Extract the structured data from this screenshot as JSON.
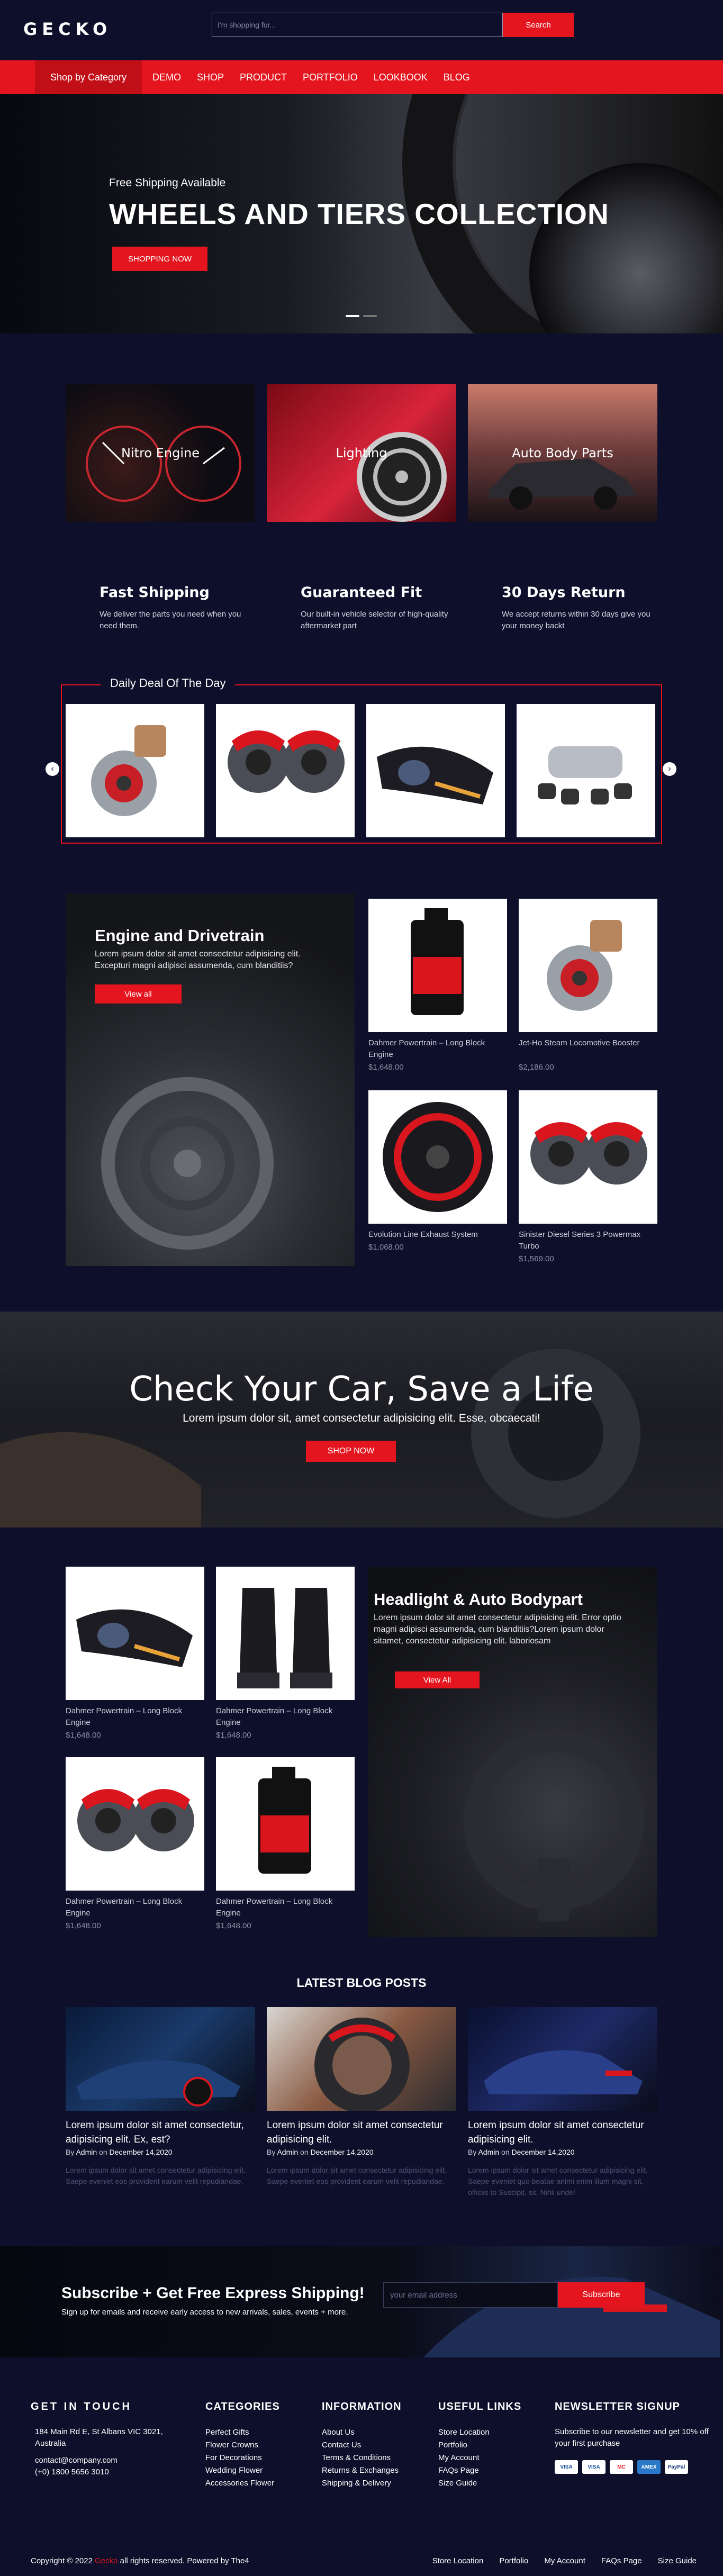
{
  "header": {
    "logo": "GECKO",
    "search_placeholder": "I'm shopping for...",
    "search_button": "Search"
  },
  "nav": {
    "shop_by_category": "Shop by Category",
    "links": [
      "DEMO",
      "SHOP",
      "PRODUCT",
      "PORTFOLIO",
      "LOOKBOOK",
      "BLOG"
    ]
  },
  "hero": {
    "subtitle": "Free Shipping Available",
    "title": "WHEELS AND TIERS COLLECTION",
    "button": "SHOPPING NOW"
  },
  "categories": [
    "Nitro Engine",
    "Lighting",
    "Auto Body Parts"
  ],
  "features": [
    {
      "title": "Fast Shipping",
      "text": "We deliver the parts you need when you need them."
    },
    {
      "title": "Guaranteed Fit",
      "text": "Our built-in vehicle selector of high-quality aftermarket part"
    },
    {
      "title": "30 Days Return",
      "text": "We accept returns within 30 days give you your money backt"
    }
  ],
  "deal": {
    "title": "Daily Deal Of The Day",
    "items": [
      "turbocharger",
      "brake-calipers",
      "headlight",
      "exhaust-system"
    ]
  },
  "engine_section": {
    "banner": {
      "title": "Engine and Drivetrain",
      "text": "Lorem ipsum dolor sit amet consectetur adipisicing elit. Excepturi magni adipisci assumenda, cum blanditiis?",
      "button": "View all"
    },
    "products": [
      {
        "name": "Dahmer Powertrain – Long Block Engine",
        "price": "$1,648.00",
        "image": "oil-bottle"
      },
      {
        "name": "Jet-Ho Steam Locomotive Booster",
        "price": "$2,186.00",
        "image": "turbocharger"
      },
      {
        "name": "Evolution Line Exhaust System",
        "price": "$1,068.00",
        "image": "wheel-rim"
      },
      {
        "name": "Sinister Diesel Series 3 Powermax Turbo",
        "price": "$1,569.00",
        "image": "brake-calipers"
      }
    ]
  },
  "mid_banner": {
    "title": "Check Your Car, Save a Life",
    "subtitle": "Lorem ipsum dolor sit, amet consectetur adipisicing elit. Esse, obcaecati!",
    "button": "SHOP NOW"
  },
  "headlight_section": {
    "banner": {
      "title": "Headlight & Auto Bodypart",
      "text": "Lorem ipsum dolor sit amet consectetur adipisicing elit. Error optio magni adipisci assumenda, cum blanditiis?Lorem ipsum dolor sitamet, consectetur adipisicing elit. laboriosam",
      "button": "View All"
    },
    "products": [
      {
        "name": "Dahmer Powertrain – Long Block Engine",
        "price": "$1,648.00",
        "image": "headlight"
      },
      {
        "name": "Dahmer Powertrain – Long Block Engine",
        "price": "$1,648.00",
        "image": "seats"
      },
      {
        "name": "Dahmer Powertrain – Long Block Engine",
        "price": "$1,648.00",
        "image": "brake-calipers"
      },
      {
        "name": "Dahmer Powertrain – Long Block Engine",
        "price": "$1,648.00",
        "image": "oil-bottle"
      }
    ]
  },
  "blog": {
    "title": "LATEST BLOG POSTS",
    "by": "By",
    "on": "on",
    "posts": [
      {
        "title": "Lorem ipsum dolor sit amet consectetur, adipisicing elit. Ex, est?",
        "author": "Admin",
        "date": "December 14,2020",
        "excerpt": "Lorem ipsum dolor sit amet consectetur adipisicing elit. Saepe eveniet eos provident earum velit repudiandae."
      },
      {
        "title": "Lorem ipsum dolor sit amet consectetur adipisicing elit.",
        "author": "Admin",
        "date": "December 14,2020",
        "excerpt": "Lorem ipsum dolor sit amet consectetur adipisicing elit. Saepe eveniet eos provident earum velit repudiandae."
      },
      {
        "title": "Lorem ipsum dolor sit amet consectetur adipisicing elit.",
        "author": "Admin",
        "date": "December 14,2020",
        "excerpt": "Lorem ipsum dolor sit amet consectetur adipisicing elit. Saepe eveniet quo beatae animi enim illum magni sit, officiis to Suscipit, sit. Nihil unde!"
      }
    ]
  },
  "subscribe": {
    "title": "Subscribe + Get Free Express Shipping!",
    "text": "Sign up for emails and receive early access to new arrivals, sales, events + more.",
    "placeholder": "your email address",
    "button": "Subscribe"
  },
  "footer": {
    "contact": {
      "title": "GET IN TOUCH",
      "address": "184 Main Rd E, St Albans VIC 3021, Australia",
      "email": "contact@company.com",
      "phone": "(+0) 1800 5656 3010"
    },
    "categories": {
      "title": "CATEGORIES",
      "items": [
        "Perfect Gifts",
        "Flower Crowns",
        "For Decorations",
        "Wedding Flower",
        "Accessories Flower"
      ]
    },
    "information": {
      "title": "INFORMATION",
      "items": [
        "About Us",
        "Contact Us",
        "Terms & Conditions",
        "Returns & Exchanges",
        "Shipping & Delivery"
      ]
    },
    "useful": {
      "title": "USEFUL LINKS",
      "items": [
        "Store Location",
        "Portfolio",
        "My Account",
        "FAQs Page",
        "Size Guide"
      ]
    },
    "newsletter": {
      "title": "NEWSLETTER SIGNUP",
      "text": "Subscribe to our newsletter and get 10% off your first purchase",
      "payments": [
        "VISA",
        "VISA",
        "MC",
        "AMEX",
        "PayPal"
      ]
    },
    "copyright_pre": "Copyright © 2022",
    "copyright_brand": "Gecko",
    "copyright_post": "all rights reserved. Powered by The4",
    "bottom_links": [
      "Store Location",
      "Portfolio",
      "My Account",
      "FAQs Page",
      "Size Guide"
    ]
  },
  "colors": {
    "accent": "#e4151f",
    "background": "#0d0f2b"
  }
}
